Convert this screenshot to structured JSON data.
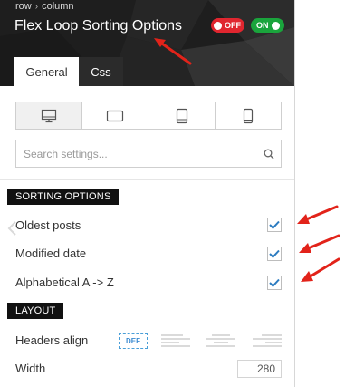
{
  "header": {
    "breadcrumb": [
      "row",
      "column"
    ],
    "breadcrumb_separator": "›",
    "title": "Flex Loop Sorting Options",
    "toggle_off_label": "OFF",
    "toggle_on_label": "ON",
    "toggle_off_color": "#e0262f",
    "toggle_on_color": "#1aa43c"
  },
  "tabs": [
    {
      "label": "General",
      "active": true
    },
    {
      "label": "Css",
      "active": false
    }
  ],
  "devices": [
    "desktop-icon",
    "tablet-landscape-icon",
    "tablet-portrait-icon",
    "mobile-icon"
  ],
  "search": {
    "placeholder": "Search settings...",
    "value": ""
  },
  "sections": {
    "sorting": {
      "title": "SORTING OPTIONS",
      "options": [
        {
          "label": "Oldest posts",
          "checked": true
        },
        {
          "label": "Modified date",
          "checked": true
        },
        {
          "label": "Alphabetical A -> Z",
          "checked": true
        }
      ]
    },
    "layout": {
      "title": "LAYOUT",
      "headers_align": {
        "label": "Headers align",
        "default_label": "DEF",
        "options": [
          "align-left-icon",
          "align-center-icon",
          "align-right-icon"
        ]
      },
      "width": {
        "label": "Width",
        "value": "280"
      }
    }
  },
  "colors": {
    "accent": "#4a9fd8",
    "check": "#2b7bc0",
    "annotation_arrow": "#e2231a"
  }
}
